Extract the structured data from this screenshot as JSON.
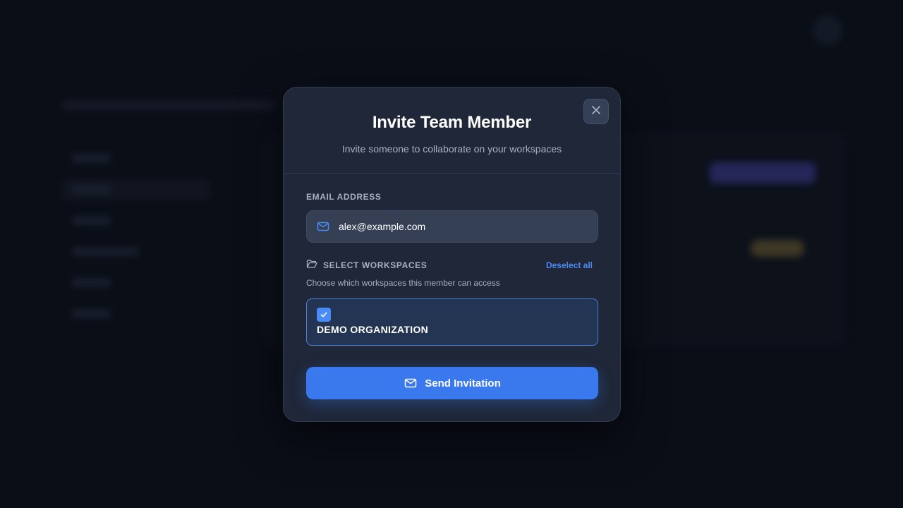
{
  "modal": {
    "title": "Invite Team Member",
    "subtitle": "Invite someone to collaborate on your workspaces",
    "close_icon": "close-icon"
  },
  "email": {
    "label": "EMAIL ADDRESS",
    "value": "alex@example.com",
    "icon": "mail-icon"
  },
  "workspaces": {
    "label": "SELECT WORKSPACES",
    "icon": "folder-icon",
    "deselect_label": "Deselect all",
    "hint": "Choose which workspaces this member can access",
    "items": [
      {
        "name": "DEMO ORGANIZATION",
        "checked": true
      }
    ]
  },
  "send": {
    "label": "Send Invitation",
    "icon": "mail-icon"
  },
  "colors": {
    "accent": "#3a78ee",
    "link": "#4a8cf7",
    "modal_bg": "#1f2738",
    "page_bg": "#0a0e17"
  }
}
